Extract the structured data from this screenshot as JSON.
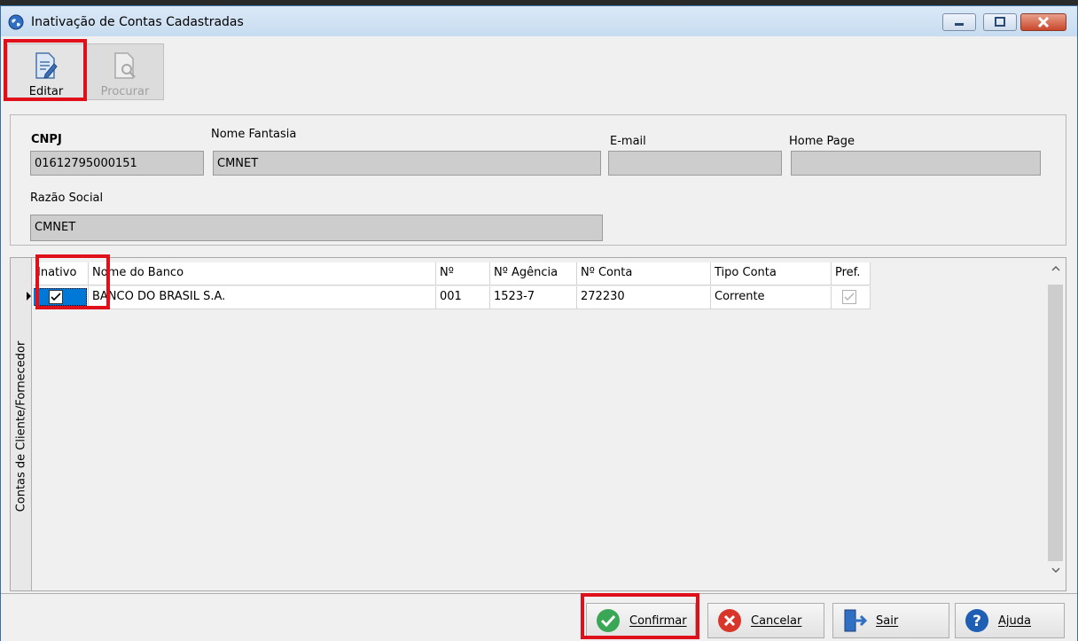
{
  "window": {
    "title": "Inativação de Contas Cadastradas"
  },
  "toolbar": {
    "edit_label": "Editar",
    "search_label": "Procurar"
  },
  "form": {
    "cnpj_label": "CNPJ",
    "cnpj_value": "01612795000151",
    "nome_fantasia_label": "Nome Fantasia",
    "nome_fantasia_value": "CMNET",
    "email_label": "E-mail",
    "email_value": "",
    "home_page_label": "Home Page",
    "home_page_value": "",
    "razao_social_label": "Razão Social",
    "razao_social_value": "CMNET"
  },
  "side_tab_label": "Contas de Cliente/Fornecedor",
  "grid": {
    "headers": [
      "Inativo",
      "Nome do Banco",
      "Nº",
      "Nº Agência",
      "Nº Conta",
      "Tipo Conta",
      "Pref."
    ],
    "rows": [
      {
        "inativo": true,
        "banco": "BANCO DO BRASIL S.A.",
        "numero": "001",
        "agencia": "1523-7",
        "conta": "272230",
        "tipo": "Corrente",
        "pref": true
      }
    ]
  },
  "actions": {
    "confirm": "Confirmar",
    "cancel": "Cancelar",
    "exit": "Sair",
    "help": "Ajuda"
  },
  "colors": {
    "highlight": "#e0101a",
    "selection": "#0078d7",
    "confirm_icon": "#3aa757",
    "cancel_icon": "#d9362b",
    "help_icon": "#1e5fb4"
  }
}
